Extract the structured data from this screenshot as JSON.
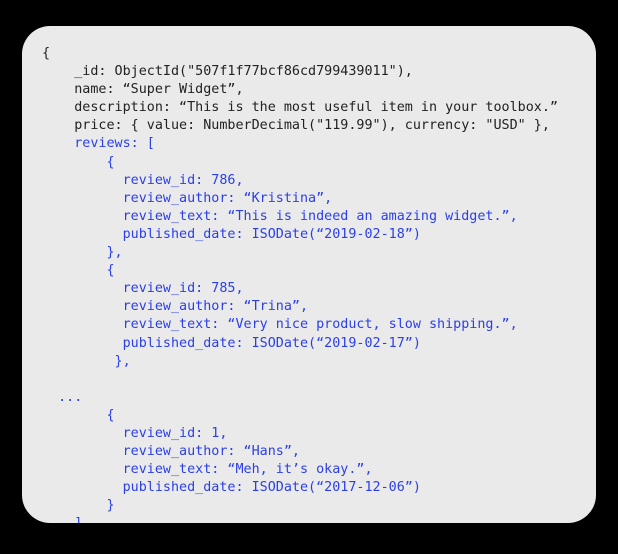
{
  "window": {
    "background_color": "#000000",
    "card_background_color": "#eaeaea",
    "text_color": "#222222",
    "highlight_color": "#2b3fe8"
  },
  "document": {
    "kind": "mongodb-document-snippet",
    "lines": [
      {
        "indent": 0,
        "text": "{",
        "color": "dark"
      },
      {
        "indent": 4,
        "text": "_id: ObjectId(\"507f1f77bcf86cd799439011\"),",
        "color": "dark"
      },
      {
        "indent": 4,
        "text": "name: “Super Widget”,",
        "color": "dark"
      },
      {
        "indent": 4,
        "text": "description: “This is the most useful item in your toolbox.”",
        "color": "dark"
      },
      {
        "indent": 4,
        "text": "price: { value: NumberDecimal(\"119.99\"), currency: \"USD\" },",
        "color": "dark"
      },
      {
        "indent": 4,
        "text": "reviews: [",
        "color": "blue"
      },
      {
        "indent": 8,
        "text": "{",
        "color": "blue"
      },
      {
        "indent": 10,
        "text": "review_id: 786,",
        "color": "blue"
      },
      {
        "indent": 10,
        "text": "review_author: “Kristina”,",
        "color": "blue"
      },
      {
        "indent": 10,
        "text": "review_text: “This is indeed an amazing widget.”,",
        "color": "blue"
      },
      {
        "indent": 10,
        "text": "published_date: ISODate(“2019-02-18”)",
        "color": "blue"
      },
      {
        "indent": 8,
        "text": "},",
        "color": "blue"
      },
      {
        "indent": 8,
        "text": "{",
        "color": "blue"
      },
      {
        "indent": 10,
        "text": "review_id: 785,",
        "color": "blue"
      },
      {
        "indent": 10,
        "text": "review_author: “Trina”,",
        "color": "blue"
      },
      {
        "indent": 10,
        "text": "review_text: “Very nice product, slow shipping.”,",
        "color": "blue"
      },
      {
        "indent": 10,
        "text": "published_date: ISODate(“2019-02-17”)",
        "color": "blue"
      },
      {
        "indent": 9,
        "text": "},",
        "color": "blue"
      },
      {
        "indent": 0,
        "text": "",
        "color": "blue"
      },
      {
        "indent": 2,
        "text": "...",
        "color": "blue"
      },
      {
        "indent": 8,
        "text": "{",
        "color": "blue"
      },
      {
        "indent": 10,
        "text": "review_id: 1,",
        "color": "blue"
      },
      {
        "indent": 10,
        "text": "review_author: “Hans”,",
        "color": "blue"
      },
      {
        "indent": 10,
        "text": "review_text: “Meh, it’s okay.”,",
        "color": "blue"
      },
      {
        "indent": 10,
        "text": "published_date: ISODate(“2017-12-06”)",
        "color": "blue"
      },
      {
        "indent": 8,
        "text": "}",
        "color": "blue"
      },
      {
        "indent": 4,
        "text": "]",
        "color": "blue"
      },
      {
        "indent": 0,
        "text": "}",
        "color": "dark"
      }
    ],
    "fields": {
      "_id": "ObjectId(\"507f1f77bcf86cd799439011\")",
      "name": "Super Widget",
      "description": "This is the most useful item in your toolbox.",
      "price_value": "119.99",
      "price_currency": "USD"
    },
    "reviews": [
      {
        "review_id": "786",
        "review_author": "Kristina",
        "review_text": "This is indeed an amazing widget.",
        "published_date": "2019-02-18"
      },
      {
        "review_id": "785",
        "review_author": "Trina",
        "review_text": "Very nice product, slow shipping.",
        "published_date": "2019-02-17"
      },
      {
        "review_id": "1",
        "review_author": "Hans",
        "review_text": "Meh, it's okay.",
        "published_date": "2017-12-06"
      }
    ],
    "truncation_marker": "..."
  }
}
